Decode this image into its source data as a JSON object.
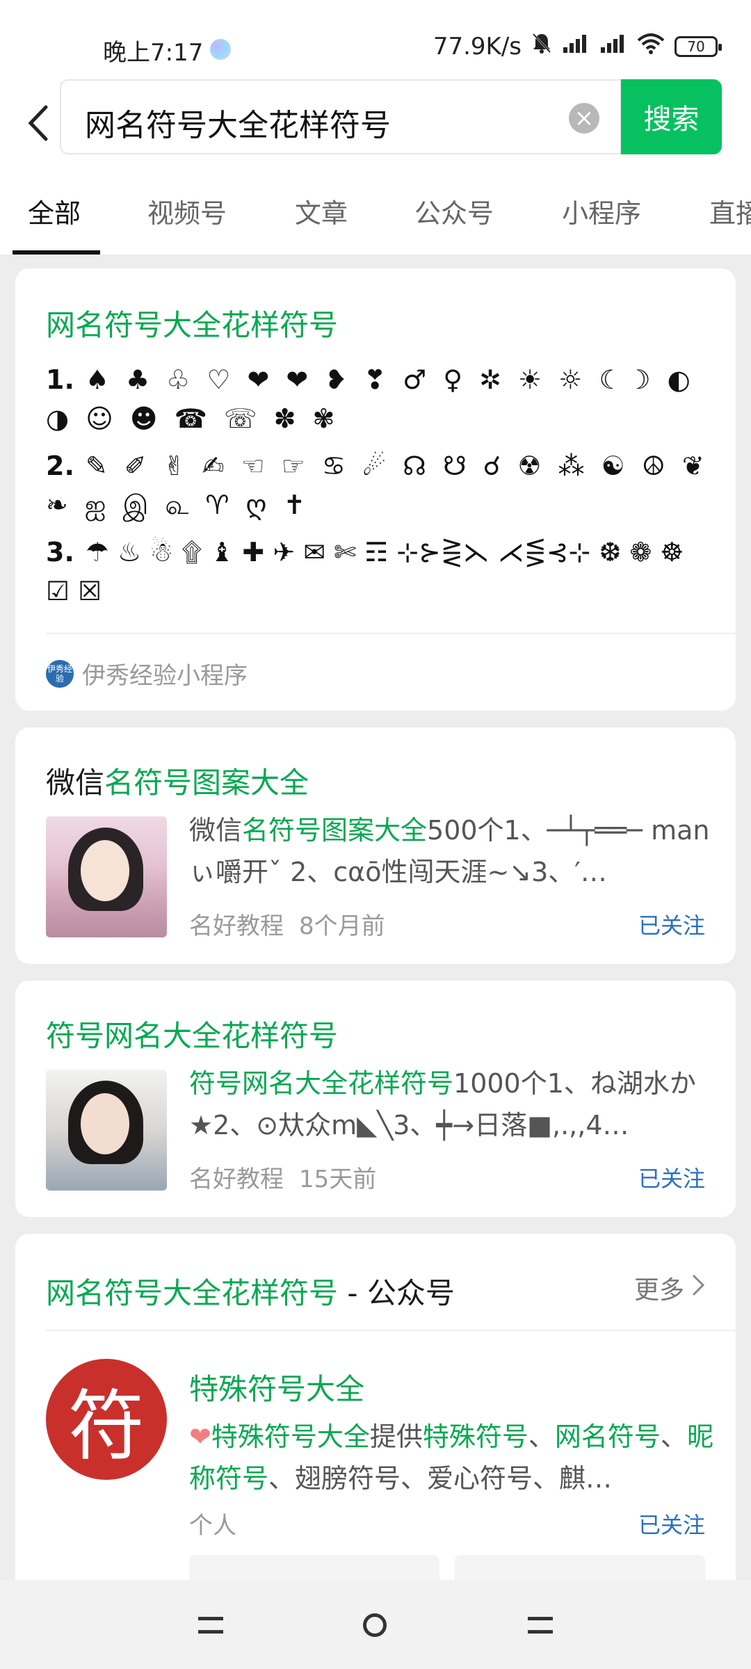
{
  "status": {
    "time": "晚上7:17",
    "net_speed": "77.9K/s",
    "battery": "70"
  },
  "search": {
    "query": "网名符号大全花样符号",
    "button": "搜索"
  },
  "tabs": [
    "全部",
    "视频号",
    "文章",
    "公众号",
    "小程序",
    "直播"
  ],
  "card1": {
    "title": "网名符号大全花样符号",
    "lines": [
      {
        "num": "1.",
        "symbols": "♠ ♣ ♧ ♡ ❤ ❤ ❥ ❣ ♂ ♀ ✲ ☀ ☼ ☾☽ ◐ ◑ ☺ ☻ ☎ ☏ ✽ ✾"
      },
      {
        "num": "2.",
        "symbols": "✎ ✐ ✌ ✍ ☜ ☞ ♋ ☄ ☊ ☋ ☌ ☢ ⁂ ☯ ☮ ❦ ❧ ஐ இ ௳ ♈ ღ ✝"
      },
      {
        "num": "3.",
        "symbols": "☂ ♨ ☃ ۩ ♝ ✚ ✈ ✉ ✄ ☶ ⊹⊱⋛⋋ ⋌⋚⊰⊹ ❆ ❁ ☸ ☑ ☒"
      }
    ],
    "source": "伊秀经验小程序",
    "source_logo": "伊秀经验"
  },
  "article1": {
    "title_plain": "微信",
    "title_highlight": "名符号图案大全",
    "desc_highlight": "名符号图案大全",
    "desc_prefix": "微信",
    "desc_rest": "500个1、─┴┬══─ manぃ嚼开ˇ 2、cαō性闯天涯~↘3、′…",
    "author": "名好教程",
    "time": "8个月前",
    "follow": "已关注"
  },
  "article2": {
    "title": "符号网名大全花样符号",
    "desc_highlight": "符号网名大全花样符号",
    "desc_rest": "1000个1、ね湖水か★2、⊙夶众m◣╲3、┿→日落■,.,,4…",
    "author": "名好教程",
    "time": "15天前",
    "follow": "已关注"
  },
  "official_accounts": {
    "header_highlight": "网名符号大全花样符号",
    "header_suffix": " - 公众号",
    "more": "更多",
    "account": {
      "logo_char": "符",
      "name": "特殊符号大全",
      "desc_heart": "❤",
      "desc_a": "特殊符号大全",
      "desc_b": "提供",
      "desc_c": "特殊符号",
      "desc_d": "、",
      "desc_e": "网名符号",
      "desc_f": "、",
      "desc_g": "昵称符号",
      "desc_h": "、翅膀符号、爱心符号、麒…",
      "type": "个人",
      "follow": "已关注"
    }
  },
  "icons": {
    "back": "back-arrow-icon",
    "clear": "clear-icon",
    "more": "chevron-right-icon",
    "nav": [
      "recents-icon",
      "home-icon",
      "back-nav-icon"
    ]
  }
}
